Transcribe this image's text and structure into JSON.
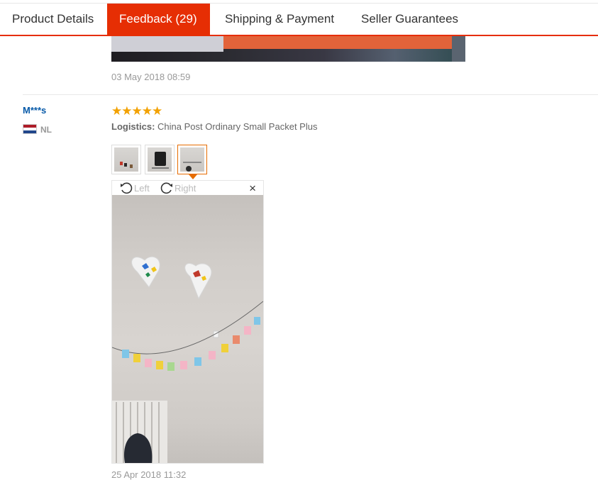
{
  "tabs": [
    {
      "label": "Product Details",
      "active": false
    },
    {
      "label": "Feedback (29)",
      "active": true
    },
    {
      "label": "Shipping & Payment",
      "active": false
    },
    {
      "label": "Seller Guarantees",
      "active": false
    }
  ],
  "previous_review": {
    "date": "03 May 2018 08:59"
  },
  "review": {
    "user": "M***s",
    "country": "NL",
    "rating": 5,
    "stars": "★★★★★",
    "logistics_label": "Logistics:",
    "logistics_value": "China Post Ordinary Small Packet Plus",
    "viewer": {
      "rotate_left": "Left",
      "rotate_right": "Right",
      "close": "×"
    },
    "date": "25 Apr 2018 11:32"
  },
  "colors": {
    "accent": "#e62e04",
    "star": "#f2a100",
    "user_link": "#0659a8",
    "thumb_active": "#e66c00"
  }
}
